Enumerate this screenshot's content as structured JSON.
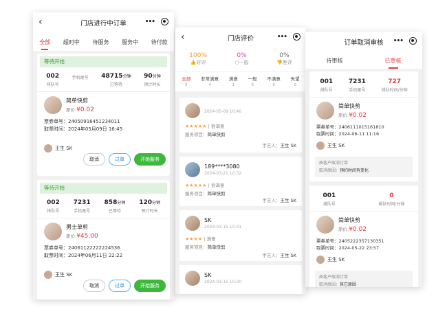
{
  "phone1": {
    "title": "门店进行中订单",
    "tabs": [
      "全部",
      "超时中",
      "待服务",
      "服务中",
      "待付款"
    ],
    "orders": [
      {
        "status": "等待开始",
        "stats": [
          {
            "value": "002",
            "unit": "",
            "label": "排队号"
          },
          {
            "value": "",
            "unit": "",
            "label": "手机尾号"
          },
          {
            "value": "48715",
            "unit": "分钟",
            "label": "已等待"
          },
          {
            "value": "90",
            "unit": "分钟",
            "label": "预计时长"
          }
        ],
        "service": "简单快剪",
        "price_label": "原价:",
        "price": "¥0.02",
        "ticket_no": "票券单号：24050916451234011",
        "ticket_time": "取票时间：2024年05月09日 16:45",
        "worker": "王生 SK",
        "buttons": [
          "取消",
          "过单",
          "开始服务"
        ]
      },
      {
        "status": "等待开始",
        "stats": [
          {
            "value": "002",
            "unit": "",
            "label": "排队号"
          },
          {
            "value": "7231",
            "unit": "",
            "label": "手机尾号"
          },
          {
            "value": "858",
            "unit": "分钟",
            "label": "已等待"
          },
          {
            "value": "120",
            "unit": "分钟",
            "label": "预计时长"
          }
        ],
        "service": "男士单剪",
        "price_label": "原价:",
        "price": "¥45.00",
        "ticket_no": "票券单号：24061122222224536",
        "ticket_time": "取票时间：2024年06月11日 22:22",
        "worker": "王生 SK",
        "buttons": [
          "取消",
          "过单",
          "开始服务"
        ]
      }
    ]
  },
  "phone2": {
    "title": "门店评价",
    "top": [
      {
        "pct": "100%",
        "label": "好评",
        "color": "#f0a030"
      },
      {
        "pct": "0%",
        "label": "一般",
        "color": "#e040a0"
      },
      {
        "pct": "0%",
        "label": "差评",
        "color": "#666666"
      }
    ],
    "tabs": [
      {
        "label": "全部",
        "count": "5"
      },
      {
        "label": "非常满意",
        "count": "4"
      },
      {
        "label": "满意",
        "count": "1"
      },
      {
        "label": "一般",
        "count": "0"
      },
      {
        "label": "不满意",
        "count": "0"
      },
      {
        "label": "失望",
        "count": "0"
      }
    ],
    "reviews": [
      {
        "name": "",
        "date": "2024-05-09 16:46",
        "stars": "★★★★★",
        "level": "| 很满意",
        "item_label": "服务项目：",
        "item": "简单快剪",
        "artist_label": "手艺人：",
        "artist": "王生 SK"
      },
      {
        "name": "189****3080",
        "date": "2024-03-21 10:32",
        "stars": "★★★★★",
        "level": "| 很满意",
        "item_label": "服务项目：",
        "item": "简单快剪",
        "artist_label": "手艺人：",
        "artist": "王生 SK"
      },
      {
        "name": "SK",
        "date": "2024-03-15 10:31",
        "stars": "★★★★",
        "level": "| 满意",
        "item_label": "服务项目：",
        "item": "简单快剪",
        "artist_label": "手艺人：",
        "artist": "王生 SK"
      },
      {
        "name": "SK",
        "date": "2024-03-15 10:30",
        "stars": "",
        "level": "",
        "item_label": "",
        "item": "",
        "artist_label": "",
        "artist": ""
      }
    ]
  },
  "phone3": {
    "title": "订单取消审核",
    "tabs": [
      "待审核",
      "已审核"
    ],
    "orders": [
      {
        "stats": [
          {
            "value": "001",
            "label": "排队号",
            "red": false
          },
          {
            "value": "7231",
            "label": "手机尾号",
            "red": false
          },
          {
            "value": "727",
            "label": "排队时间/分钟",
            "red": true
          }
        ],
        "service": "简单快剪",
        "price_label": "原价:",
        "price": "¥0.02",
        "ticket_no": "票券单号：2406111015161810",
        "ticket_time": "取票时间：2024-06-11 11:16",
        "worker": "王生 SK",
        "cancel_by": "由客户取消订单",
        "reason_label": "取消原因：",
        "reason": "预约时间有变化"
      },
      {
        "stats": [
          {
            "value": "001",
            "label": "排队号",
            "red": false
          },
          {
            "value": "",
            "label": "",
            "red": false
          },
          {
            "value": "0",
            "label": "排队时间/分钟",
            "red": true
          }
        ],
        "service": "简单快剪",
        "price_label": "原价:",
        "price": "¥0.02",
        "ticket_no": "票券单号：2405222357130351",
        "ticket_time": "取票时间：2024-05-22 23:57",
        "worker": "王生 SK",
        "cancel_by": "由客户取消订单",
        "reason_label": "取消原因：",
        "reason": "其它原因"
      }
    ]
  }
}
